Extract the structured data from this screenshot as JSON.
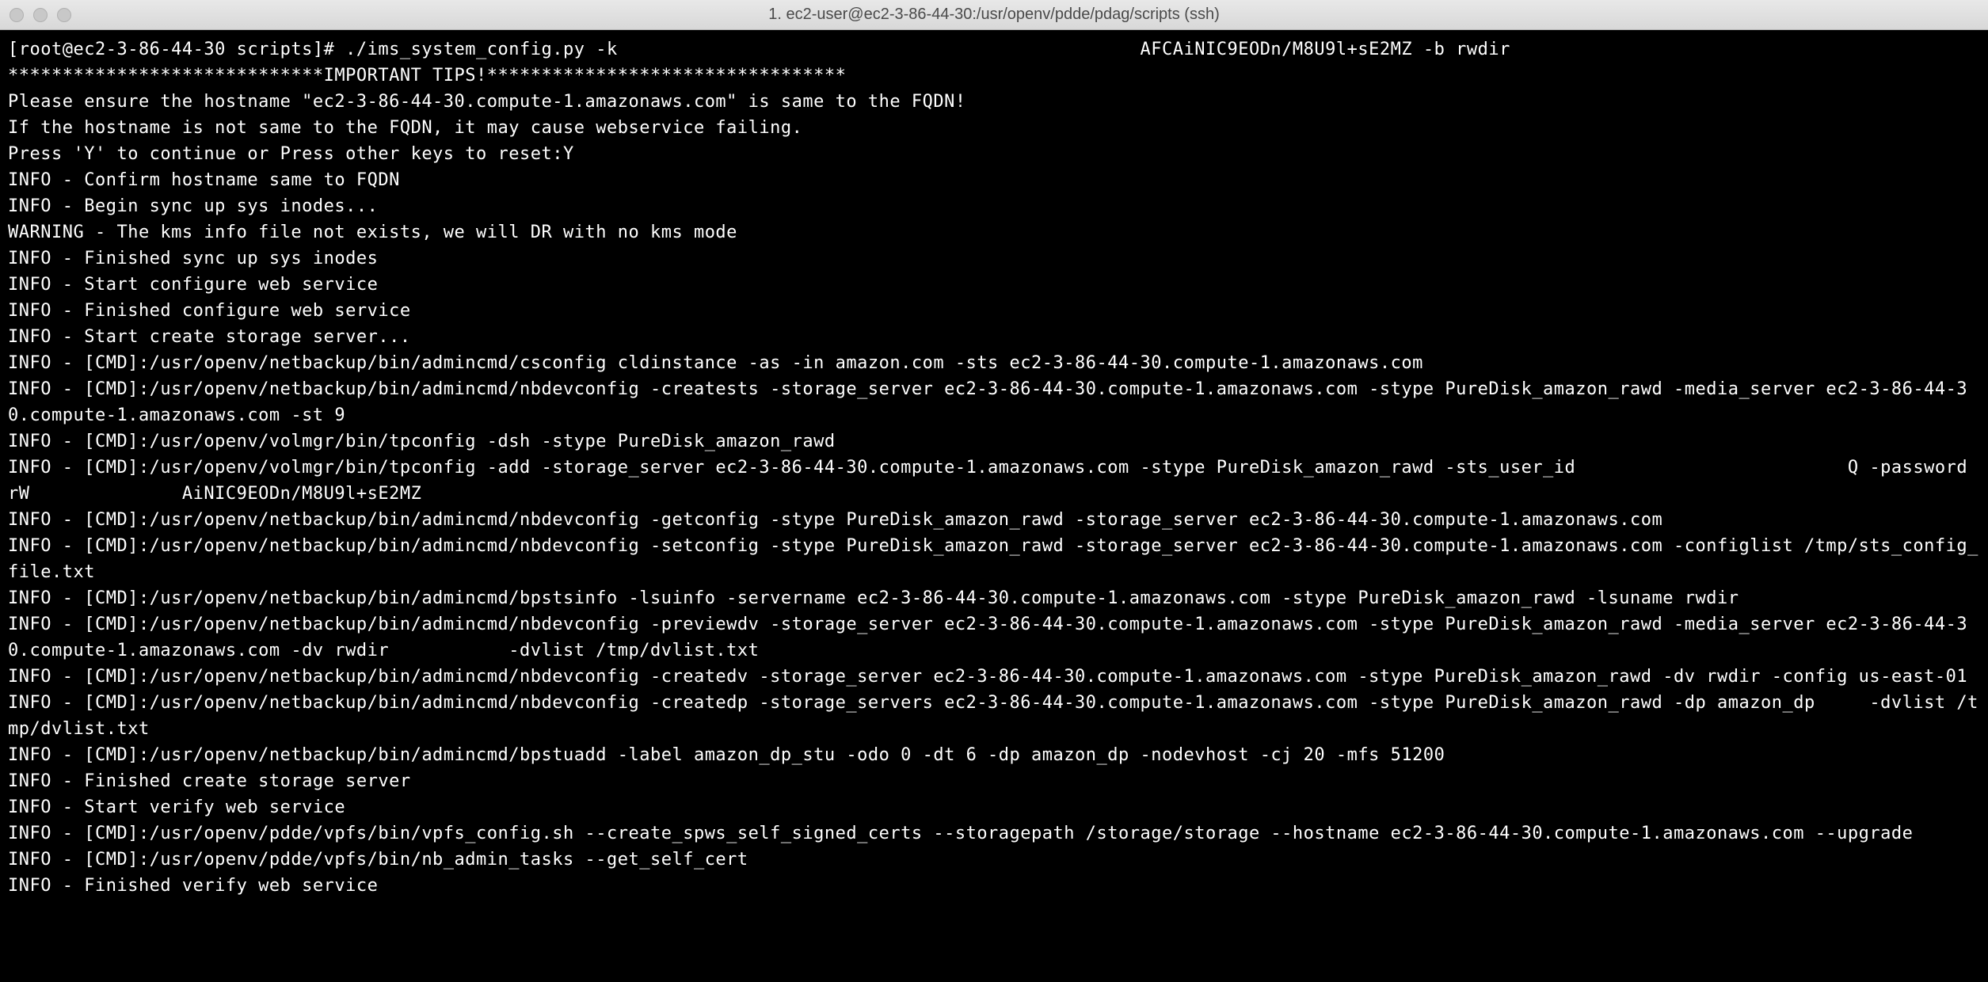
{
  "window": {
    "title": "1. ec2-user@ec2-3-86-44-30:/usr/openv/pdde/pdag/scripts (ssh)"
  },
  "terminal": {
    "lines": [
      "[root@ec2-3-86-44-30 scripts]# ./ims_system_config.py -k                                                AFCAiNIC9EODn/M8U9l+sE2MZ -b rwdir",
      "",
      "*****************************IMPORTANT TIPS!*********************************",
      "Please ensure the hostname \"ec2-3-86-44-30.compute-1.amazonaws.com\" is same to the FQDN!",
      "If the hostname is not same to the FQDN, it may cause webservice failing.",
      "Press 'Y' to continue or Press other keys to reset:Y",
      "INFO - Confirm hostname same to FQDN",
      "INFO - Begin sync up sys inodes...",
      "WARNING - The kms info file not exists, we will DR with no kms mode",
      "INFO - Finished sync up sys inodes",
      "INFO - Start configure web service",
      "INFO - Finished configure web service",
      "INFO - Start create storage server...",
      "INFO - [CMD]:/usr/openv/netbackup/bin/admincmd/csconfig cldinstance -as -in amazon.com -sts ec2-3-86-44-30.compute-1.amazonaws.com",
      "INFO - [CMD]:/usr/openv/netbackup/bin/admincmd/nbdevconfig -creatests -storage_server ec2-3-86-44-30.compute-1.amazonaws.com -stype PureDisk_amazon_rawd -media_server ec2-3-86-44-30.compute-1.amazonaws.com -st 9",
      "INFO - [CMD]:/usr/openv/volmgr/bin/tpconfig -dsh -stype PureDisk_amazon_rawd",
      "INFO - [CMD]:/usr/openv/volmgr/bin/tpconfig -add -storage_server ec2-3-86-44-30.compute-1.amazonaws.com -stype PureDisk_amazon_rawd -sts_user_id                         Q -password rW              AiNIC9EODn/M8U9l+sE2MZ",
      "INFO - [CMD]:/usr/openv/netbackup/bin/admincmd/nbdevconfig -getconfig -stype PureDisk_amazon_rawd -storage_server ec2-3-86-44-30.compute-1.amazonaws.com",
      "INFO - [CMD]:/usr/openv/netbackup/bin/admincmd/nbdevconfig -setconfig -stype PureDisk_amazon_rawd -storage_server ec2-3-86-44-30.compute-1.amazonaws.com -configlist /tmp/sts_config_file.txt",
      "INFO - [CMD]:/usr/openv/netbackup/bin/admincmd/bpstsinfo -lsuinfo -servername ec2-3-86-44-30.compute-1.amazonaws.com -stype PureDisk_amazon_rawd -lsuname rwdir",
      "INFO - [CMD]:/usr/openv/netbackup/bin/admincmd/nbdevconfig -previewdv -storage_server ec2-3-86-44-30.compute-1.amazonaws.com -stype PureDisk_amazon_rawd -media_server ec2-3-86-44-30.compute-1.amazonaws.com -dv rwdir           -dvlist /tmp/dvlist.txt",
      "INFO - [CMD]:/usr/openv/netbackup/bin/admincmd/nbdevconfig -createdv -storage_server ec2-3-86-44-30.compute-1.amazonaws.com -stype PureDisk_amazon_rawd -dv rwdir -config us-east-01",
      "INFO - [CMD]:/usr/openv/netbackup/bin/admincmd/nbdevconfig -createdp -storage_servers ec2-3-86-44-30.compute-1.amazonaws.com -stype PureDisk_amazon_rawd -dp amazon_dp     -dvlist /tmp/dvlist.txt",
      "INFO - [CMD]:/usr/openv/netbackup/bin/admincmd/bpstuadd -label amazon_dp_stu -odo 0 -dt 6 -dp amazon_dp -nodevhost -cj 20 -mfs 51200",
      "INFO - Finished create storage server",
      "INFO - Start verify web service",
      "INFO - [CMD]:/usr/openv/pdde/vpfs/bin/vpfs_config.sh --create_spws_self_signed_certs --storagepath /storage/storage --hostname ec2-3-86-44-30.compute-1.amazonaws.com --upgrade",
      "INFO - [CMD]:/usr/openv/pdde/vpfs/bin/nb_admin_tasks --get_self_cert",
      "INFO - Finished verify web service"
    ]
  }
}
